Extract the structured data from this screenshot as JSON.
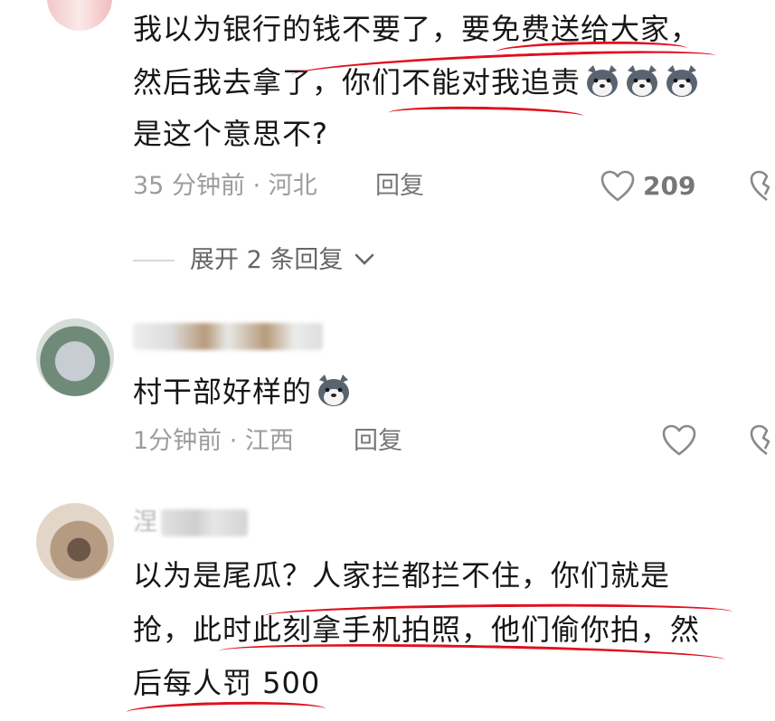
{
  "comments": [
    {
      "lines": [
        "我以为银行的钱不要了，要免费送给大家，",
        "然后我去拿了，你们不能对我追责",
        "是这个意思不?"
      ],
      "emoji_count": 3,
      "emoji_icon": "husky-dog-emoji-icon",
      "time_location": "35 分钟前 · 河北",
      "reply_label": "回复",
      "likes": "209"
    },
    {
      "lines": [
        "村干部好样的"
      ],
      "emoji_count": 1,
      "emoji_icon": "husky-dog-emoji-icon",
      "time_location": "1分钟前 · 江西",
      "reply_label": "回复",
      "likes": ""
    },
    {
      "lines": [
        "以为是尾瓜？人家拦都拦不住，你们就是",
        "抢，此时此刻拿手机拍照，他们偷你拍，然",
        "后每人罚 500"
      ],
      "name_partial": "涅"
    }
  ],
  "expand_replies_label": "展开 2 条回复",
  "colors": {
    "underline": "#e0101e",
    "meta": "#9c9c9c",
    "text": "#161616"
  }
}
